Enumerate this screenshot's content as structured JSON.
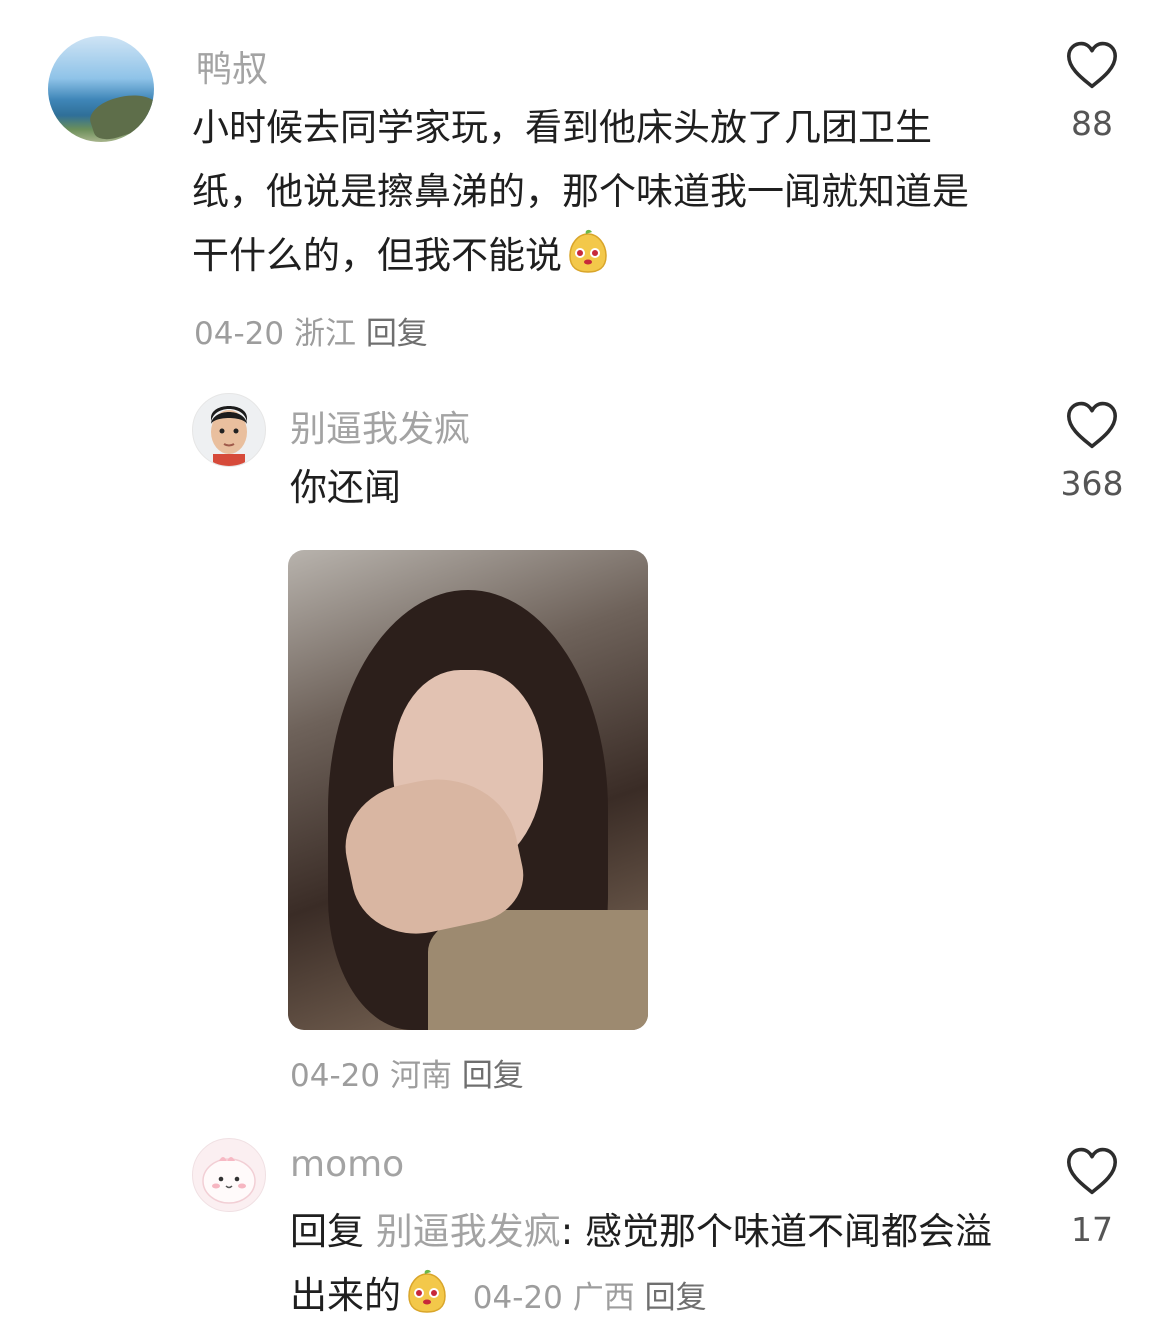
{
  "comments": [
    {
      "username": "鸭叔",
      "text": "小时候去同学家玩，看到他床头放了几团卫生纸，他说是擦鼻涕的，那个味道我一闻就知道是干什么的，但我不能说",
      "emoji": "smirk-emoji",
      "date": "04-20",
      "location": "浙江",
      "reply_label": "回复",
      "likes": "88"
    },
    {
      "username": "别逼我发疯",
      "text": "你还闻",
      "image": "reaction-photo",
      "date": "04-20",
      "location": "河南",
      "reply_label": "回复",
      "likes": "368"
    },
    {
      "username": "momo",
      "reply_prefix": "回复",
      "reply_to": "别逼我发疯",
      "text": ": 感觉那个味道不闻都会溢出来的",
      "emoji": "smirk-emoji",
      "date": "04-20",
      "location": "广西",
      "reply_label": "回复",
      "likes": "17"
    }
  ],
  "icons": {
    "like": "heart-outline-icon"
  },
  "colors": {
    "username": "#a3a3a3",
    "meta": "#9d9d9d",
    "text": "#1f1f1f"
  }
}
